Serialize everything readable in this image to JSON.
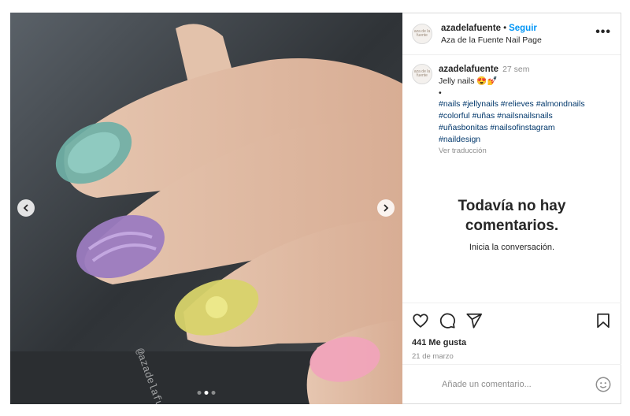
{
  "post": {
    "username": "azadelafuente",
    "separator": "•",
    "follow_label": "Seguir",
    "page_name": "Aza de la Fuente Nail Page",
    "more_label": "•••",
    "avatar_text": "aza de la fuente",
    "watermark": "@azadelafuente"
  },
  "caption": {
    "username": "azadelafuente",
    "time": "27 sem",
    "text": "Jelly nails 😍💅",
    "bullet": "•",
    "hashtags_line1": "#nails #jellynails #relieves #almondnails",
    "hashtags_line2": "#colorful #uñas #nailsnailsnails",
    "hashtags_line3": "#uñasbonitas #nailsofinstagram",
    "hashtags_line4": "#naildesign",
    "translate_label": "Ver traducción"
  },
  "comments": {
    "empty_title": "Todavía no hay comentarios.",
    "empty_subtitle": "Inicia la conversación."
  },
  "engagement": {
    "likes": "441 Me gusta",
    "date": "21 de marzo"
  },
  "comment_input": {
    "placeholder": "Añade un comentario..."
  },
  "carousel": {
    "total_slides": 3,
    "active_slide": 2
  },
  "colors": {
    "accent": "#0095f6",
    "hashtag": "#00376b",
    "muted": "#8e8e8e",
    "border": "#dbdbdb"
  }
}
